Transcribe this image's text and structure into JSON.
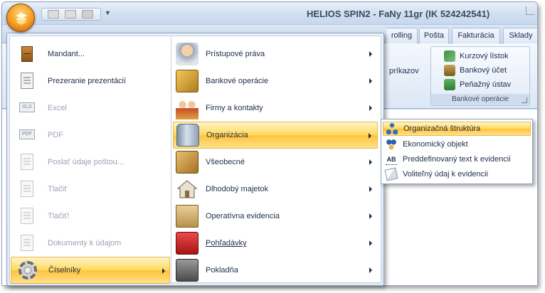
{
  "window": {
    "title": "HELIOS SPIN2 - FaNy 11gr (IK 524242541)"
  },
  "quick_access": {
    "icons": [
      "save-icon",
      "save-all-icon",
      "printer-icon"
    ],
    "customize_arrow": "▼"
  },
  "ribbon_tabs": [
    "rolling",
    "Pošta",
    "Fakturácia",
    "Sklady"
  ],
  "ribbon": {
    "partial_button": "príkazov",
    "group_bank": {
      "caption": "Bankové operácie",
      "items": [
        {
          "label": "Kurzový lístok",
          "icon": "exchange-rate-icon"
        },
        {
          "label": "Bankový účet",
          "icon": "bank-account-icon"
        },
        {
          "label": "Peňažný ústav",
          "icon": "bank-institution-icon"
        }
      ]
    }
  },
  "office_menu": {
    "left_items": [
      {
        "label": "Mandant...",
        "icon": "cabinet-icon",
        "enabled": true,
        "selected": false,
        "submenu": false
      },
      {
        "label": "Prezeranie prezentácií",
        "icon": "presentation-icon",
        "enabled": true,
        "selected": false,
        "submenu": false
      },
      {
        "label": "Excel",
        "icon": "excel-icon",
        "icon_text": "XLS",
        "enabled": false,
        "selected": false,
        "submenu": false
      },
      {
        "label": "PDF",
        "icon": "pdf-icon",
        "icon_text": "PDF",
        "enabled": false,
        "selected": false,
        "submenu": false
      },
      {
        "label": "Poslať údaje poštou...",
        "icon": "send-mail-icon",
        "enabled": false,
        "selected": false,
        "submenu": false
      },
      {
        "label": "Tlačiť",
        "icon": "printer-icon",
        "enabled": false,
        "selected": false,
        "submenu": false
      },
      {
        "label": "Tlačiť!",
        "icon": "printer-quick-icon",
        "enabled": false,
        "selected": false,
        "submenu": false
      },
      {
        "label": "Dokumenty k údajom",
        "icon": "documents-icon",
        "enabled": false,
        "selected": false,
        "submenu": false
      },
      {
        "label": "Číselníky",
        "icon": "gear-icon",
        "enabled": true,
        "selected": true,
        "submenu": true
      }
    ],
    "right_items": [
      {
        "label": "Prístupové práva",
        "icon": "access-rights-icon",
        "selected": false
      },
      {
        "label": "Bankové operácie",
        "icon": "bank-operations-icon",
        "selected": false
      },
      {
        "label": "Firmy a kontakty",
        "icon": "contacts-icon",
        "selected": false
      },
      {
        "label": "Organizácia",
        "icon": "organization-icon",
        "selected": true
      },
      {
        "label": "Všeobecné",
        "icon": "general-icon",
        "selected": false
      },
      {
        "label": "Dlhodobý majetok",
        "icon": "house-icon",
        "selected": false
      },
      {
        "label": "Operatívna evidencia",
        "icon": "boxes-icon",
        "selected": false
      },
      {
        "label": "Pohľadávky",
        "icon": "receivables-icon",
        "selected": false
      },
      {
        "label": "Pokladňa",
        "icon": "cash-register-icon",
        "selected": false
      }
    ]
  },
  "submenu": {
    "items": [
      {
        "label": "Organizačná štruktúra",
        "icon": "org-structure-icon",
        "selected": true
      },
      {
        "label": "Ekonomický objekt",
        "icon": "economic-object-icon",
        "selected": false
      },
      {
        "label": "Preddefinovaný text k evidencii",
        "icon": "predefined-text-icon",
        "icon_text": "AB",
        "selected": false
      },
      {
        "label": "Voliteľný údaj k evidencii",
        "icon": "optional-field-icon",
        "selected": false
      }
    ]
  }
}
